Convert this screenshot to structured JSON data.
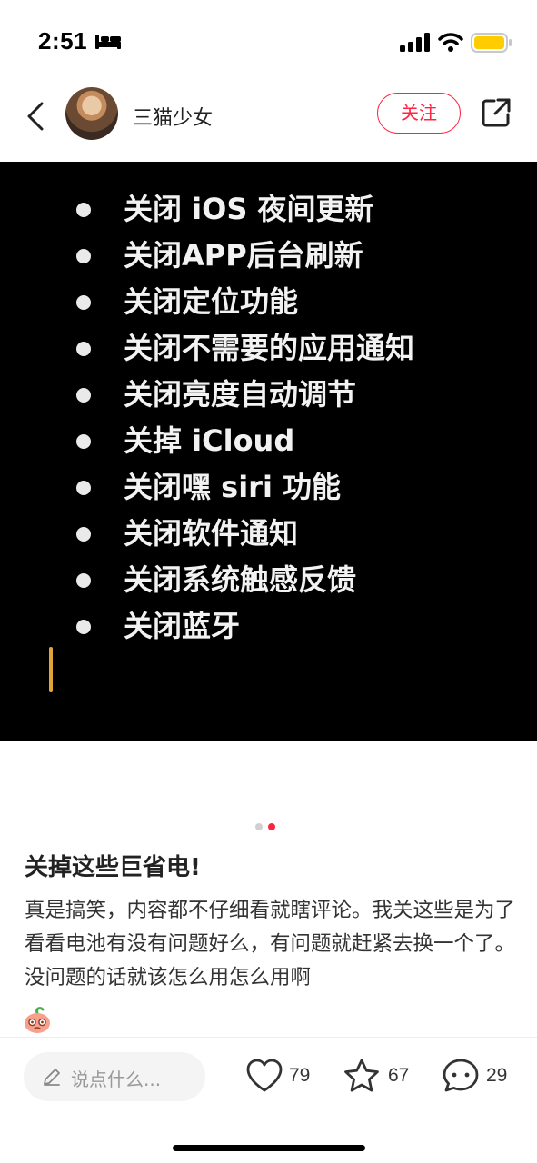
{
  "status_bar": {
    "time": "2:51"
  },
  "nav": {
    "author": "三猫少女",
    "follow_label": "关注"
  },
  "media": {
    "bullets": [
      "关闭 iOS 夜间更新",
      "关闭APP后台刷新",
      "关闭定位功能",
      "关闭不需要的应用通知",
      "关闭亮度自动调节",
      "关掉 iCloud",
      "关闭嘿 siri 功能",
      "关闭软件通知",
      "关闭系统触感反馈",
      "关闭蓝牙"
    ],
    "cursor_color": "#e0a43a"
  },
  "pager": {
    "count": 2,
    "active_index": 1,
    "active_color": "#ff2442",
    "inactive_color": "#d0d0d0"
  },
  "note": {
    "title": "关掉这些巨省电!",
    "body": "真是搞笑，内容都不仔细看就瞎评论。我关这些是为了看看电池有没有问题好么，有问题就赶紧去换一个了。没问题的话就该怎么用怎么用啊",
    "emoji_icon": "peach-face-emoji-icon"
  },
  "bottom_bar": {
    "comment_placeholder": "说点什么...",
    "likes": "79",
    "collects": "67",
    "comments": "29"
  },
  "colors": {
    "accent": "#ff2442",
    "battery": "#ffcc00"
  }
}
